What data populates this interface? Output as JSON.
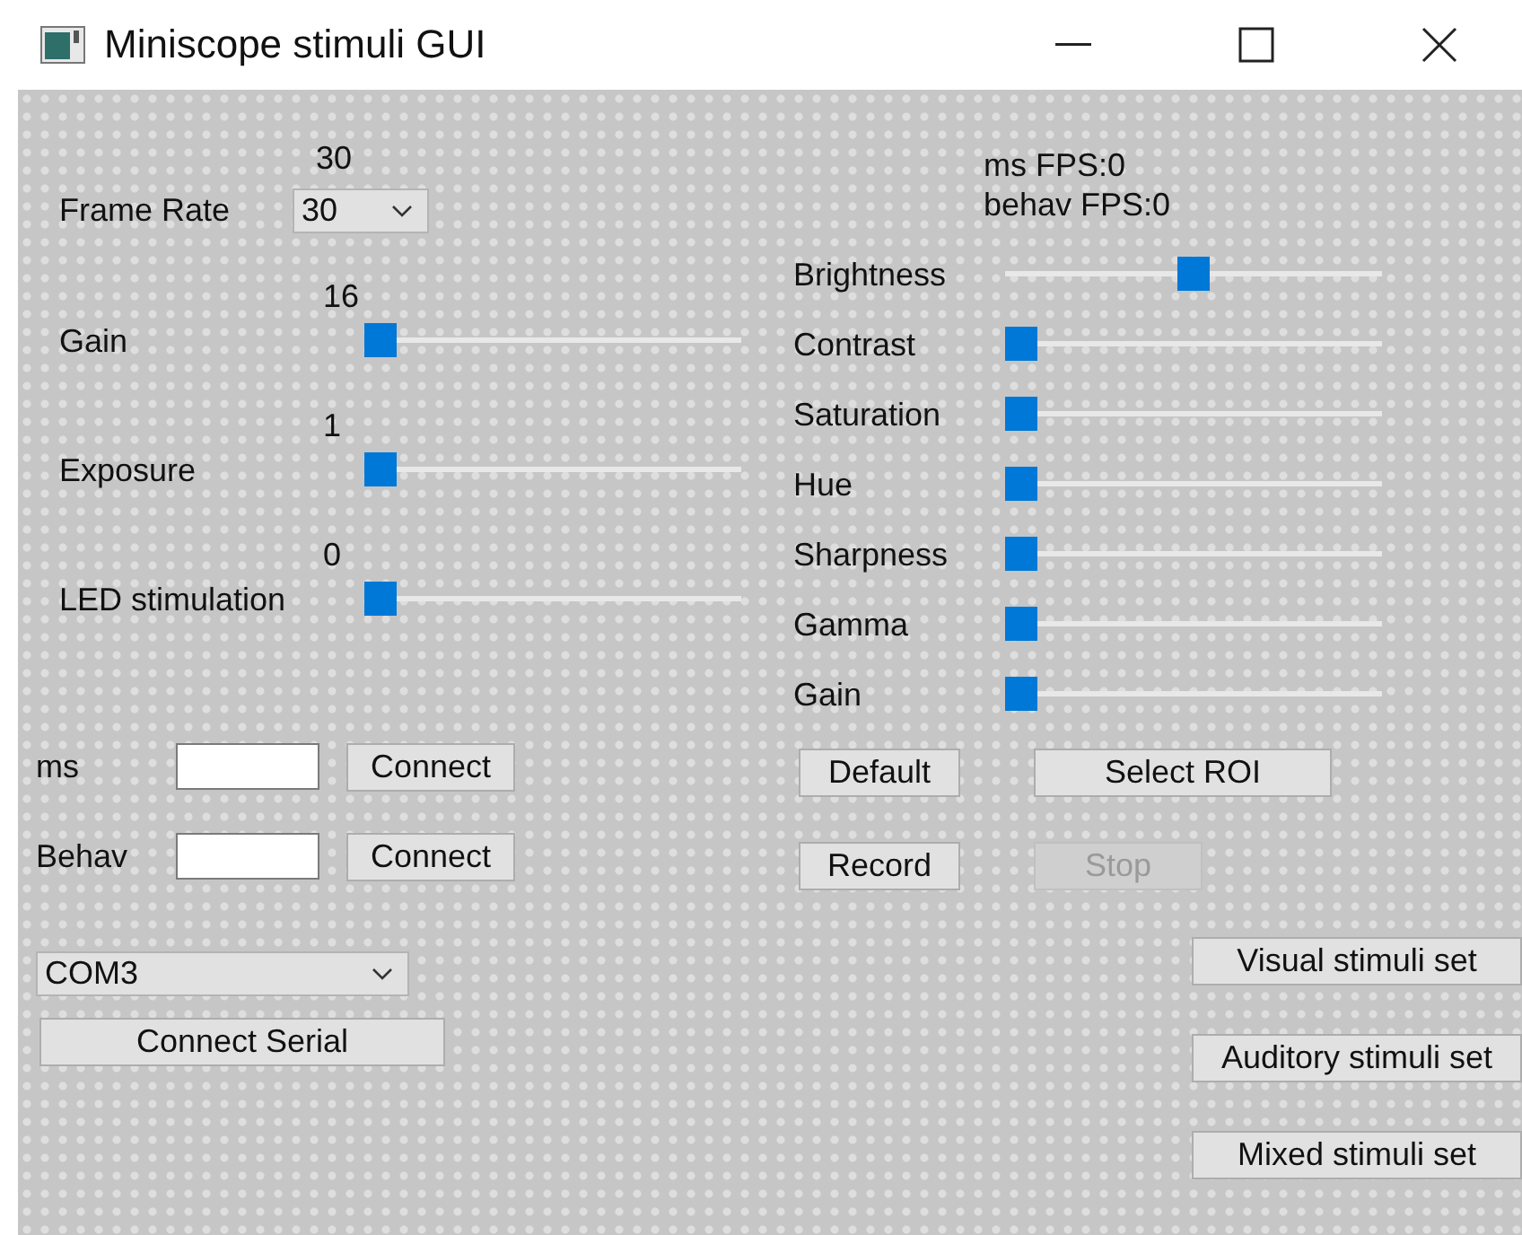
{
  "window": {
    "title": "Miniscope stimuli GUI"
  },
  "frame_rate": {
    "label": "Frame Rate",
    "reading": "30",
    "value": "30"
  },
  "sliders": [
    {
      "label": "Gain",
      "reading": "16",
      "level": 0
    },
    {
      "label": "Exposure",
      "reading": "1",
      "level": 0
    },
    {
      "label": "LED stimulation",
      "reading": "0",
      "level": 0
    }
  ],
  "connections": [
    {
      "label": "ms",
      "button": "Connect"
    },
    {
      "label": "Behav",
      "button": "Connect"
    }
  ],
  "serial": {
    "port": "COM3",
    "button": "Connect Serial"
  },
  "fps": [
    "ms FPS:0",
    "behav FPS:0"
  ],
  "camera_controls": [
    {
      "label": "Brightness",
      "level": 0.5
    },
    {
      "label": "Contrast",
      "level": 0
    },
    {
      "label": "Saturation",
      "level": 0
    },
    {
      "label": "Hue",
      "level": 0
    },
    {
      "label": "Sharpness",
      "level": 0
    },
    {
      "label": "Gamma",
      "level": 0
    },
    {
      "label": "Gain",
      "level": 0
    }
  ],
  "buttons": [
    {
      "label": "Default",
      "disabled": false,
      "kind": "short"
    },
    {
      "label": "Select ROI",
      "disabled": false,
      "kind": "wide"
    },
    {
      "label": "Record",
      "disabled": false,
      "kind": "short"
    },
    {
      "label": "Stop",
      "disabled": true,
      "kind": "medium"
    }
  ],
  "stimuli_buttons": [
    "Visual stimuli set",
    "Auditory stimuli set",
    "Mixed stimuli set"
  ]
}
